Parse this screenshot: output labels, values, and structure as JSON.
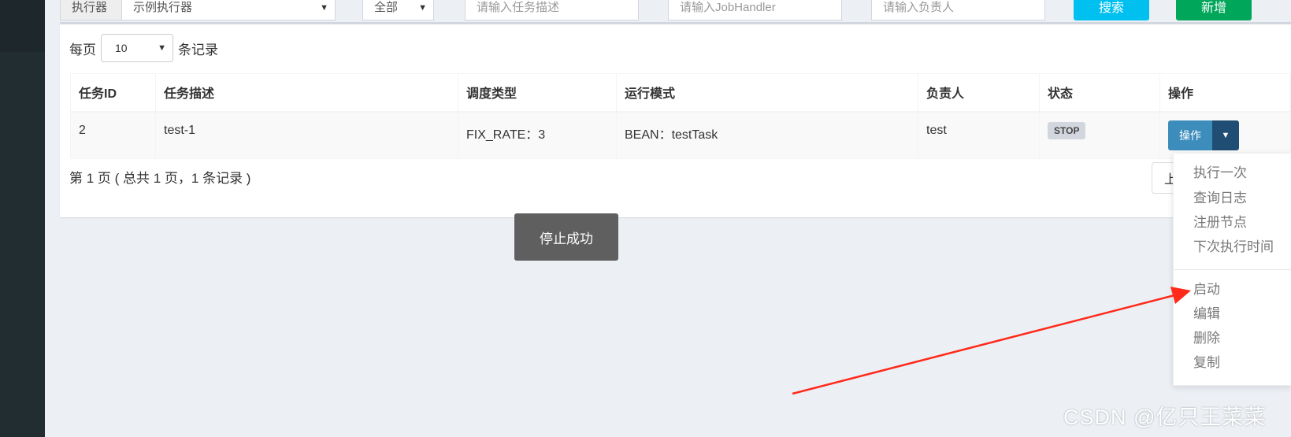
{
  "filters": {
    "executor_label": "执行器",
    "executor_value": "示例执行器",
    "status_value": "全部",
    "desc_placeholder": "请输入任务描述",
    "handler_placeholder": "请输入JobHandler",
    "author_placeholder": "请输入负责人",
    "search_label": "搜索",
    "add_label": "新增"
  },
  "page_size": {
    "prefix": "每页",
    "value": "10",
    "suffix": "条记录"
  },
  "table": {
    "headers": [
      "任务ID",
      "任务描述",
      "调度类型",
      "运行模式",
      "负责人",
      "状态",
      "操作"
    ],
    "rows": [
      {
        "id": "2",
        "desc": "test-1",
        "schedule": "FIX_RATE：3",
        "mode": "BEAN：testTask",
        "author": "test",
        "status": "STOP",
        "action": "操作"
      }
    ]
  },
  "pagination": {
    "info": "第 1 页 ( 总共 1 页，1 条记录 )",
    "prev": "上"
  },
  "dropdown": {
    "items": [
      "执行一次",
      "查询日志",
      "注册节点",
      "下次执行时间"
    ],
    "items2": [
      "启动",
      "编辑",
      "删除",
      "复制"
    ]
  },
  "toast": "停止成功",
  "watermark": "CSDN @亿只王菜菜",
  "colors": {
    "primary": "#3c8dbc",
    "primary_dark": "#204d74",
    "search": "#00c0ef",
    "add": "#00a65a",
    "arrow": "#ff2a1a"
  },
  "icons": {
    "select": "chevron-down-icon",
    "caret": "caret-down-icon"
  }
}
